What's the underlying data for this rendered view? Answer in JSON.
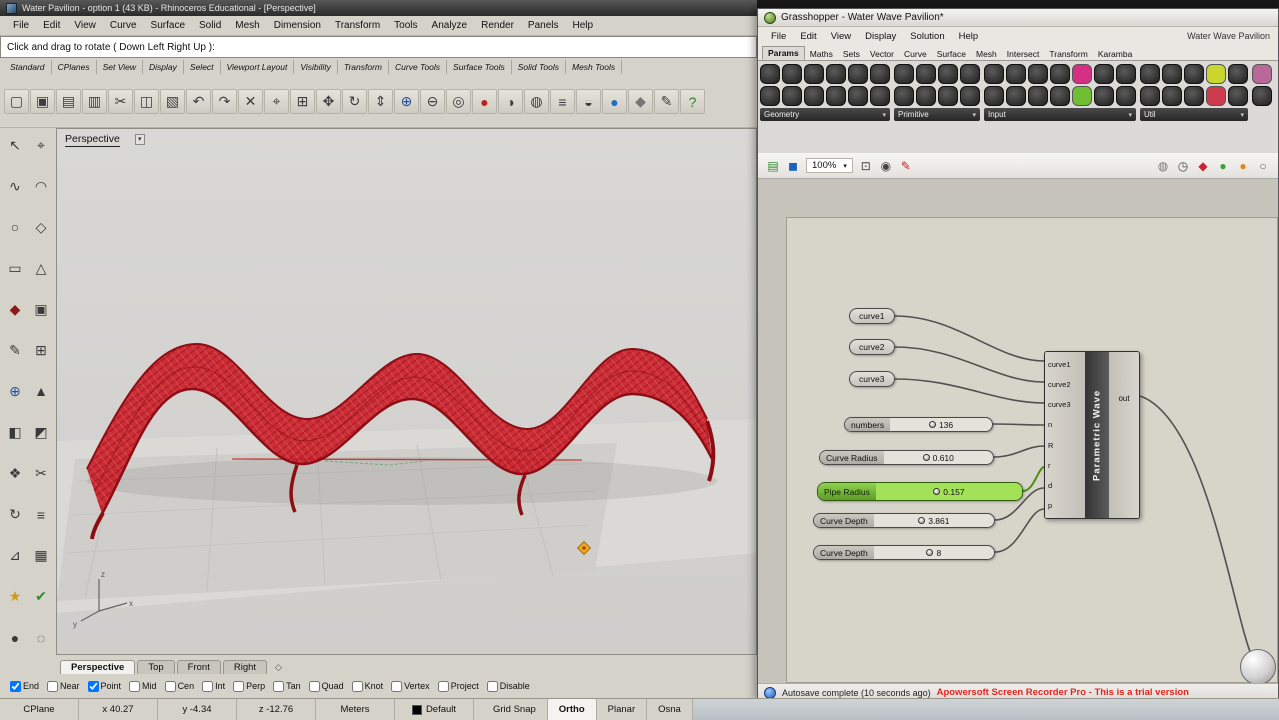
{
  "rhino": {
    "title": "Water Pavilion - option 1 (43 KB) - Rhinoceros Educational - [Perspective]",
    "menu": [
      "File",
      "Edit",
      "View",
      "Curve",
      "Surface",
      "Solid",
      "Mesh",
      "Dimension",
      "Transform",
      "Tools",
      "Analyze",
      "Render",
      "Panels",
      "Help"
    ],
    "command_prompt": "Click and drag to rotate ( Down  Left  Right  Up ):",
    "toolbar_tabs": [
      "Standard",
      "CPlanes",
      "Set View",
      "Display",
      "Select",
      "Viewport Layout",
      "Visibility",
      "Transform",
      "Curve Tools",
      "Surface Tools",
      "Solid Tools",
      "Mesh Tools"
    ],
    "toolbar_icons": [
      {
        "g": "▢",
        "n": "new-file-icon"
      },
      {
        "g": "▣",
        "n": "open-file-icon"
      },
      {
        "g": "▤",
        "n": "save-file-icon"
      },
      {
        "g": "▥",
        "n": "print-icon"
      },
      {
        "g": "✂",
        "n": "cut-icon"
      },
      {
        "g": "◫",
        "n": "copy-icon"
      },
      {
        "g": "▧",
        "n": "paste-icon"
      },
      {
        "g": "↶",
        "n": "undo-icon"
      },
      {
        "g": "↷",
        "n": "redo-icon"
      },
      {
        "g": "✕",
        "n": "delete-icon"
      },
      {
        "g": "⌖",
        "n": "pointer-icon"
      },
      {
        "g": "⊞",
        "n": "grid-snap-icon"
      },
      {
        "g": "✥",
        "n": "pan-icon"
      },
      {
        "g": "↻",
        "n": "rotate-view-icon"
      },
      {
        "g": "⇕",
        "n": "scale-icon"
      },
      {
        "g": "⊕",
        "n": "zoom-in-icon",
        "c": "#1f4e9c"
      },
      {
        "g": "⊖",
        "n": "zoom-out-icon"
      },
      {
        "g": "◎",
        "n": "zoom-extents-icon"
      },
      {
        "g": "●",
        "n": "render-icon",
        "c": "#bb2222"
      },
      {
        "g": "◑",
        "n": "shaded-view-icon"
      },
      {
        "g": "◍",
        "n": "wireframe-view-icon"
      },
      {
        "g": "≡",
        "n": "layer-panel-icon"
      },
      {
        "g": "◒",
        "n": "display-mode-icon"
      },
      {
        "g": "●",
        "n": "material-sphere-icon",
        "c": "#1f6fbf"
      },
      {
        "g": "◆",
        "n": "osnap-icon",
        "c": "#777777"
      },
      {
        "g": "✎",
        "n": "annotate-icon"
      },
      {
        "g": "?",
        "n": "help-icon",
        "c": "#2a7a2a"
      }
    ],
    "sidebar_icons": [
      {
        "g": "↖",
        "n": "select-arrow-icon"
      },
      {
        "g": "⌖",
        "n": "point-icon"
      },
      {
        "g": "∿",
        "n": "curve-icon"
      },
      {
        "g": "◠",
        "n": "arc-icon"
      },
      {
        "g": "○",
        "n": "circle-icon"
      },
      {
        "g": "◇",
        "n": "ellipse-icon"
      },
      {
        "g": "▭",
        "n": "rectangle-icon"
      },
      {
        "g": "△",
        "n": "polygon-icon"
      },
      {
        "g": "◆",
        "n": "solid-icon",
        "c": "#8b1a1a"
      },
      {
        "g": "▣",
        "n": "surface-icon"
      },
      {
        "g": "✎",
        "n": "sketch-icon"
      },
      {
        "g": "⊞",
        "n": "plane-icon"
      },
      {
        "g": "⊕",
        "n": "boolean-icon",
        "c": "#1f4e9c"
      },
      {
        "g": "▲",
        "n": "mesh-icon"
      },
      {
        "g": "◧",
        "n": "trim-icon"
      },
      {
        "g": "◩",
        "n": "split-icon"
      },
      {
        "g": "❖",
        "n": "array-icon"
      },
      {
        "g": "✂",
        "n": "cut-tool-icon"
      },
      {
        "g": "↻",
        "n": "rotate-tool-icon"
      },
      {
        "g": "≡",
        "n": "layers-tool-icon"
      },
      {
        "g": "⊿",
        "n": "fillet-icon"
      },
      {
        "g": "▦",
        "n": "grid-tool-icon"
      },
      {
        "g": "★",
        "n": "star-icon",
        "c": "#cf9a12"
      },
      {
        "g": "✔",
        "n": "check-icon",
        "c": "#2e8b2e"
      },
      {
        "g": "●",
        "n": "dot-icon"
      },
      {
        "g": "◌",
        "n": "dashed-circle-icon"
      }
    ],
    "viewport_label": "Perspective",
    "viewport_tabs": [
      "Perspective",
      "Top",
      "Front",
      "Right"
    ],
    "osnap": [
      {
        "label": "End",
        "checked": true
      },
      {
        "label": "Near",
        "checked": false
      },
      {
        "label": "Point",
        "checked": true
      },
      {
        "label": "Mid",
        "checked": false
      },
      {
        "label": "Cen",
        "checked": false
      },
      {
        "label": "Int",
        "checked": false
      },
      {
        "label": "Perp",
        "checked": false
      },
      {
        "label": "Tan",
        "checked": false
      },
      {
        "label": "Quad",
        "checked": false
      },
      {
        "label": "Knot",
        "checked": false
      },
      {
        "label": "Vertex",
        "checked": false
      },
      {
        "label": "Project",
        "checked": false
      },
      {
        "label": "Disable",
        "checked": false
      }
    ],
    "status_fields": [
      "CPlane",
      "x 40.27",
      "y -4.34",
      "z -12.76",
      "Meters",
      "Default"
    ],
    "status_buttons": [
      {
        "label": "Grid Snap",
        "active": false
      },
      {
        "label": "Ortho",
        "active": true
      },
      {
        "label": "Planar",
        "active": false
      },
      {
        "label": "Osna",
        "active": false
      }
    ]
  },
  "grasshopper": {
    "title": "Grasshopper - Water Wave Pavilion*",
    "menu": [
      "File",
      "Edit",
      "View",
      "Display",
      "Solution",
      "Help"
    ],
    "doc_label": "Water Wave Pavilion",
    "tabs": [
      "Params",
      "Maths",
      "Sets",
      "Vector",
      "Curve",
      "Surface",
      "Mesh",
      "Intersect",
      "Transform",
      "Karamba"
    ],
    "active_tab_index": 0,
    "palette_groups": [
      {
        "label": "Geometry",
        "cols": 6,
        "accents": {}
      },
      {
        "label": "Primitive",
        "cols": 4,
        "accents": {}
      },
      {
        "label": "Input",
        "cols": 7,
        "accents": {
          "0-4": "#d63084",
          "1-4": "#6fbe34"
        }
      },
      {
        "label": "Util",
        "cols": 5,
        "accents": {
          "0-3": "#c9d62e",
          "1-3": "#cf3b4e"
        }
      },
      {
        "label": "",
        "cols": 1,
        "accents": {
          "0-0": "#b8699a"
        }
      }
    ],
    "zoom_level": "100%",
    "toolbar_left_icons": [
      {
        "g": "▤",
        "c": "#2e8b2e",
        "n": "new-document-icon"
      },
      {
        "g": "◼",
        "c": "#1f5fbf",
        "n": "save-document-icon"
      }
    ],
    "toolbar_mid_icons": [
      {
        "g": "⊡",
        "n": "zoom-target-icon"
      },
      {
        "g": "◉",
        "n": "preview-eye-icon"
      },
      {
        "g": "✎",
        "c": "#cc2222",
        "n": "sketch-tool-icon"
      }
    ],
    "toolbar_right_icons": [
      {
        "g": "◍",
        "c": "#777777",
        "n": "shaded-sphere-icon"
      },
      {
        "g": "◷",
        "c": "#444444",
        "n": "profiler-clock-icon"
      },
      {
        "g": "◆",
        "c": "#cc2233",
        "n": "warning-diamond-icon"
      },
      {
        "g": "●",
        "c": "#3aa13a",
        "n": "green-sphere-icon"
      },
      {
        "g": "●",
        "c": "#e0841e",
        "n": "orange-sphere-icon"
      },
      {
        "g": "○",
        "c": "#666666",
        "n": "white-sphere-icon"
      }
    ],
    "canvas": {
      "params": [
        {
          "label": "curve1"
        },
        {
          "label": "curve2"
        },
        {
          "label": "curve3"
        }
      ],
      "sliders": [
        {
          "label": "numbers",
          "value": "136"
        },
        {
          "label": "Curve Radius",
          "value": "0.610"
        },
        {
          "label": "Pipe Radius",
          "value": "0.157"
        },
        {
          "label": "Curve Depth",
          "value": "3.861"
        },
        {
          "label": "Curve Depth",
          "value": "8"
        }
      ],
      "component": {
        "name": "Parametric Wave",
        "inputs": [
          "curve1",
          "curve2",
          "curve3",
          "n",
          "R",
          "r",
          "d",
          "p"
        ],
        "output": "out"
      }
    },
    "statusbar": {
      "autosave": "Autosave complete (10 seconds ago)",
      "trial": "Apowersoft Screen Recorder Pro - This is a trial version"
    }
  }
}
